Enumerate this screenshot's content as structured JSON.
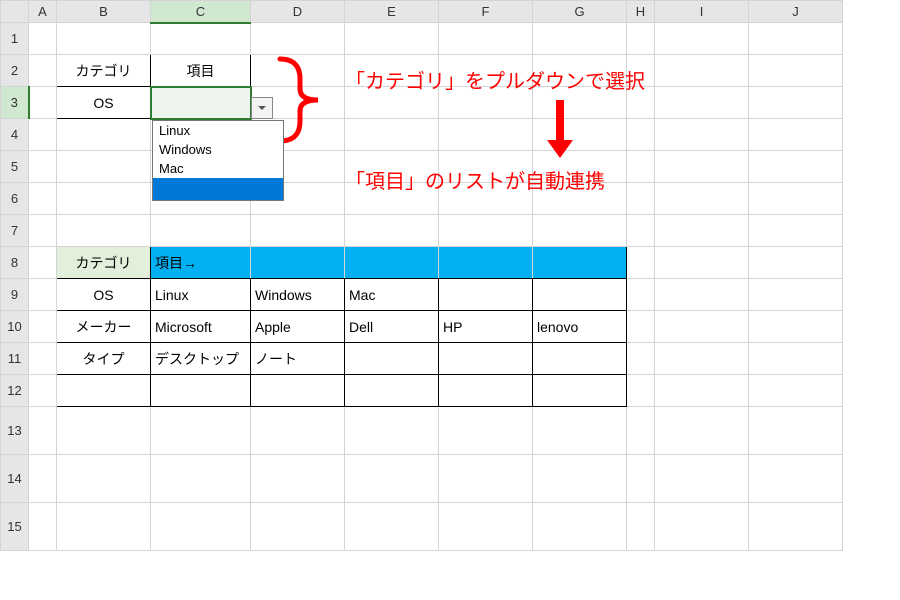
{
  "columns": [
    "A",
    "B",
    "C",
    "D",
    "E",
    "F",
    "G",
    "H",
    "I",
    "J"
  ],
  "rows": [
    1,
    2,
    3,
    4,
    5,
    6,
    7,
    8,
    9,
    10,
    11,
    12,
    13,
    14,
    15
  ],
  "active_cell": "C3",
  "top": {
    "header_category": "カテゴリ",
    "header_item": "項目",
    "category_value": "OS",
    "dropdown_options": [
      "Linux",
      "Windows",
      "Mac"
    ]
  },
  "annotation": {
    "line1": "「カテゴリ」をプルダウンで選択",
    "line2": "「項目」のリストが自動連携"
  },
  "table": {
    "cat_header": "カテゴリ",
    "item_header": "項目→",
    "rows": [
      {
        "cat": "OS",
        "items": [
          "Linux",
          "Windows",
          "Mac",
          "",
          ""
        ]
      },
      {
        "cat": "メーカー",
        "items": [
          "Microsoft",
          "Apple",
          "Dell",
          "HP",
          "lenovo"
        ]
      },
      {
        "cat": "タイプ",
        "items": [
          "デスクトップ",
          "ノート",
          "",
          "",
          ""
        ]
      }
    ]
  }
}
